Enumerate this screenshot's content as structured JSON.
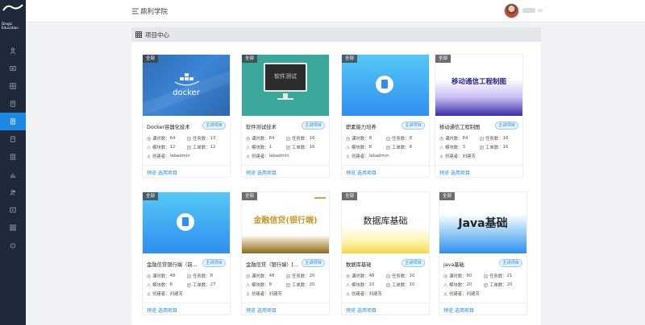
{
  "sidebar": {
    "logo_line1": "DingLi",
    "logo_line2": "Education",
    "items": [
      {
        "icon": "user-icon"
      },
      {
        "icon": "message-icon"
      },
      {
        "icon": "grid-icon"
      },
      {
        "icon": "book-icon"
      },
      {
        "icon": "document-icon",
        "active": true
      },
      {
        "icon": "file-icon"
      },
      {
        "icon": "file-list-icon"
      },
      {
        "icon": "chart-icon"
      },
      {
        "icon": "users-icon"
      },
      {
        "icon": "play-icon"
      },
      {
        "icon": "apps-icon"
      },
      {
        "icon": "power-icon"
      }
    ],
    "active_color": "#1e88e5",
    "bg_color": "#1e2a3a"
  },
  "header": {
    "title": "鼎利学院"
  },
  "panel": {
    "title": "项目中心"
  },
  "cards": [
    {
      "tag": "全部",
      "name": "Docker容器化技术",
      "badge": "主讲项目",
      "hours_label": "课时数：",
      "hours": "64",
      "tasks_label": "任务数：",
      "tasks": "13",
      "modules_label": "模块数：",
      "modules": "12",
      "orders_label": "工单数：",
      "orders": "12",
      "creator_label": "创建者：",
      "creator": "labadmin",
      "preview": "预览",
      "select": "选用项目",
      "thumb_text": "docker"
    },
    {
      "tag": "全部",
      "name": "软件测试技术",
      "badge": "主讲项目",
      "hours_label": "课时数：",
      "hours": "64",
      "tasks_label": "任务数：",
      "tasks": "16",
      "modules_label": "模块数：",
      "modules": "1",
      "orders_label": "工单数：",
      "orders": "16",
      "creator_label": "创建者：",
      "creator": "labadmin",
      "preview": "预览",
      "select": "选用项目",
      "thumb_text": "软件测试"
    },
    {
      "tag": "全部",
      "name": "职素能力培养",
      "badge": "主讲项目",
      "hours_label": "课时数：",
      "hours": "8",
      "tasks_label": "任务数：",
      "tasks": "8",
      "modules_label": "模块数：",
      "modules": "8",
      "orders_label": "工单数：",
      "orders": "8",
      "creator_label": "创建者：",
      "creator": "labadmin",
      "preview": "预览",
      "select": "选用项目",
      "thumb_text": ""
    },
    {
      "tag": "全部",
      "name": "移动通信工程制图",
      "badge": "主讲项目",
      "hours_label": "课时数：",
      "hours": "64",
      "tasks_label": "任务数：",
      "tasks": "16",
      "modules_label": "模块数：",
      "modules": "3",
      "orders_label": "工单数：",
      "orders": "16",
      "creator_label": "创建者：",
      "creator": "刘建芳",
      "preview": "预览",
      "select": "选用项目",
      "thumb_text": "移动通信工程制图"
    },
    {
      "tag": "全部",
      "name": "金融信贷银行端（前...",
      "badge": "主讲项目",
      "hours_label": "课时数：",
      "hours": "48",
      "tasks_label": "任务数：",
      "tasks": "8",
      "modules_label": "模块数：",
      "modules": "8",
      "orders_label": "工单数：",
      "orders": "27",
      "creator_label": "创建者：",
      "creator": "刘建芳",
      "preview": "预览",
      "select": "选用项目",
      "thumb_text": ""
    },
    {
      "tag": "全部",
      "name": "金融信贷（银行端）[...",
      "badge": "主讲项目",
      "hours_label": "课时数：",
      "hours": "48",
      "tasks_label": "任务数：",
      "tasks": "20",
      "modules_label": "模块数：",
      "modules": "8",
      "orders_label": "工单数：",
      "orders": "20",
      "creator_label": "创建者：",
      "creator": "刘建芳",
      "preview": "预览",
      "select": "选用项目",
      "thumb_text": "金融信贷(银行端)"
    },
    {
      "tag": "全部",
      "name": "数据库基础",
      "badge": "主讲项目",
      "hours_label": "课时数：",
      "hours": "48",
      "tasks_label": "任务数：",
      "tasks": "10",
      "modules_label": "模块数：",
      "modules": "10",
      "orders_label": "工单数：",
      "orders": "10",
      "creator_label": "创建者：",
      "creator": "刘建芳",
      "preview": "预览",
      "select": "选用项目",
      "thumb_text": "数据库基础"
    },
    {
      "tag": "全部",
      "name": "java基础",
      "badge": "主讲项目",
      "hours_label": "课时数：",
      "hours": "80",
      "tasks_label": "任务数：",
      "tasks": "21",
      "modules_label": "模块数：",
      "modules": "20",
      "orders_label": "工单数：",
      "orders": "20",
      "creator_label": "创建者：",
      "creator": "刘建芳",
      "preview": "预览",
      "select": "选用项目",
      "thumb_text": "Java基础"
    }
  ]
}
